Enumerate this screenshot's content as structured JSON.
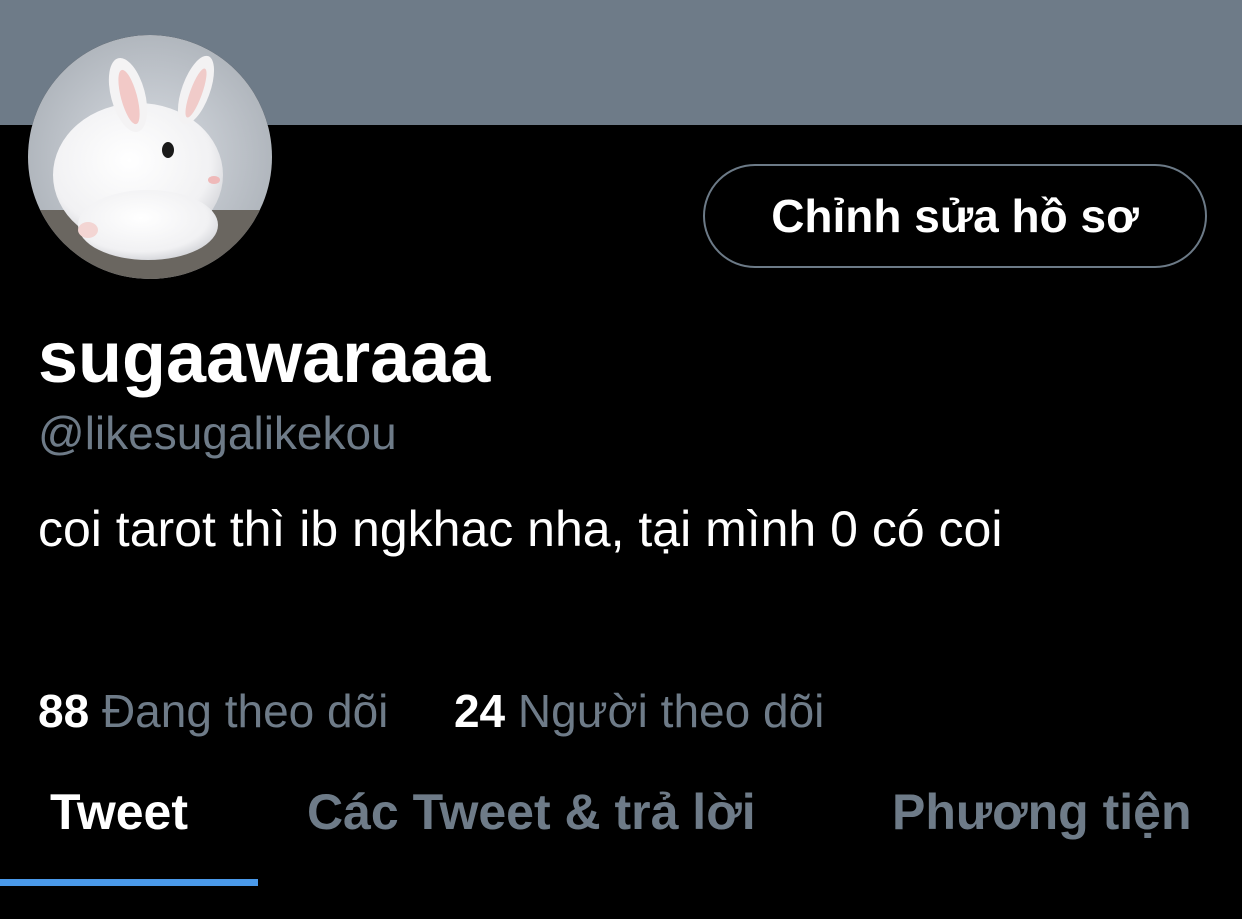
{
  "profile": {
    "display_name": "sugaawaraaa",
    "handle": "@likesugalikekou",
    "bio": "coi tarot thì ib ngkhac nha, tại mình 0 có coi",
    "edit_button_label": "Chỉnh sửa hồ sơ",
    "avatar_icon": "white-bunny-avatar"
  },
  "stats": {
    "following_count": "88",
    "following_label": "Đang theo dõi",
    "followers_count": "24",
    "followers_label": "Người theo dõi"
  },
  "tabs": [
    {
      "label": "Tweet",
      "active": true
    },
    {
      "label": "Các Tweet & trả lời",
      "active": false
    },
    {
      "label": "Phương tiện",
      "active": false
    }
  ],
  "colors": {
    "banner": "#6e7b88",
    "background": "#000000",
    "muted_text": "#6e7b88",
    "accent": "#4a99e9"
  }
}
